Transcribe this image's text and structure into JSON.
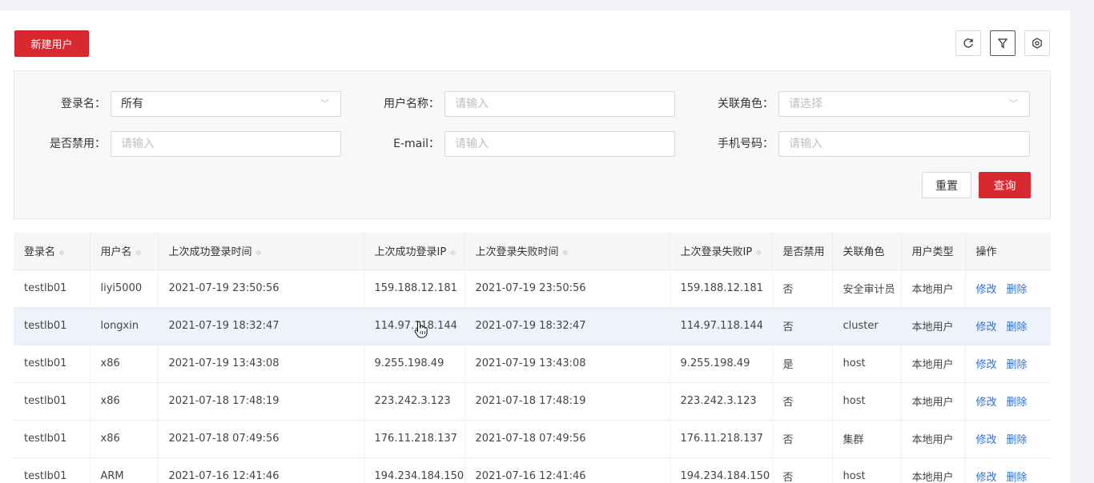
{
  "toolbar": {
    "new_user": "新建用户",
    "refresh_icon": "refresh-icon",
    "filter_icon": "filter-icon",
    "settings_icon": "settings-icon"
  },
  "filters": {
    "login_name": {
      "label": "登录名：",
      "value": "所有"
    },
    "user_name": {
      "label": "用户名称：",
      "placeholder": "请输入"
    },
    "role": {
      "label": "关联角色：",
      "placeholder": "请选择"
    },
    "disabled": {
      "label": "是否禁用：",
      "placeholder": "请输入"
    },
    "email": {
      "label": "E-mail：",
      "placeholder": "请输入"
    },
    "phone": {
      "label": "手机号码：",
      "placeholder": "请输入"
    },
    "reset": "重置",
    "query": "查询"
  },
  "table": {
    "headers": [
      "登录名",
      "用户名",
      "上次成功登录时间",
      "上次成功登录IP",
      "上次登录失败时间",
      "上次登录失败IP",
      "是否禁用",
      "关联角色",
      "用户类型",
      "操作"
    ],
    "sort_icon": "≑",
    "rows": [
      {
        "login": "testlb01",
        "name": "liyi5000",
        "ok_time": "2021-07-19 23:50:56",
        "ok_ip": "159.188.12.181",
        "fail_time": "2021-07-19 23:50:56",
        "fail_ip": "159.188.12.181",
        "disabled": "否",
        "role": "安全审计员",
        "type": "本地用户",
        "edit": "修改",
        "del": "删除"
      },
      {
        "login": "testlb01",
        "name": "longxin",
        "ok_time": "2021-07-19 18:32:47",
        "ok_ip": "114.97.118.144",
        "fail_time": "2021-07-19 18:32:47",
        "fail_ip": "114.97.118.144",
        "disabled": "否",
        "role": "cluster",
        "type": "本地用户",
        "edit": "修改",
        "del": "删除"
      },
      {
        "login": "testlb01",
        "name": "x86",
        "ok_time": "2021-07-19 13:43:08",
        "ok_ip": "9.255.198.49",
        "fail_time": "2021-07-19 13:43:08",
        "fail_ip": "9.255.198.49",
        "disabled": "是",
        "role": "host",
        "type": "本地用户",
        "edit": "修改",
        "del": "删除"
      },
      {
        "login": "testlb01",
        "name": "x86",
        "ok_time": "2021-07-18 17:48:19",
        "ok_ip": "223.242.3.123",
        "fail_time": "2021-07-18 17:48:19",
        "fail_ip": "223.242.3.123",
        "disabled": "否",
        "role": "host",
        "type": "本地用户",
        "edit": "修改",
        "del": "删除"
      },
      {
        "login": "testlb01",
        "name": "x86",
        "ok_time": "2021-07-18 07:49:56",
        "ok_ip": "176.11.218.137",
        "fail_time": "2021-07-18 07:49:56",
        "fail_ip": "176.11.218.137",
        "disabled": "否",
        "role": "集群",
        "type": "本地用户",
        "edit": "修改",
        "del": "删除"
      },
      {
        "login": "testlb01",
        "name": "ARM",
        "ok_time": "2021-07-16 12:41:46",
        "ok_ip": "194.234.184.150",
        "fail_time": "2021-07-16 12:41:46",
        "fail_ip": "194.234.184.150",
        "disabled": "否",
        "role": "host",
        "type": "本地用户",
        "edit": "修改",
        "del": "删除"
      }
    ]
  },
  "colors": {
    "primary": "#d8292f",
    "link": "#2b6fd6",
    "row_hover": "#eef3fb"
  }
}
